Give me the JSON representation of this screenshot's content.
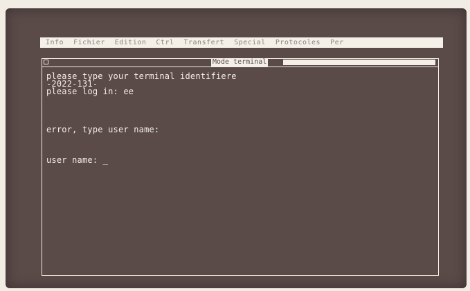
{
  "menu": {
    "items": [
      {
        "label": "Info"
      },
      {
        "label": "Fichier"
      },
      {
        "label": "Edition"
      },
      {
        "label": "Ctrl"
      },
      {
        "label": "Transfert"
      },
      {
        "label": "Special"
      },
      {
        "label": "Protocoles"
      },
      {
        "label": "Per"
      }
    ]
  },
  "window": {
    "title": "Mode terminal"
  },
  "terminal": {
    "lines": [
      "please type your terminal identifiere",
      "-2022-131-",
      "please log in: ee",
      "",
      "",
      "",
      "",
      "error, type user name:",
      "",
      "",
      "",
      "user name: _"
    ]
  }
}
